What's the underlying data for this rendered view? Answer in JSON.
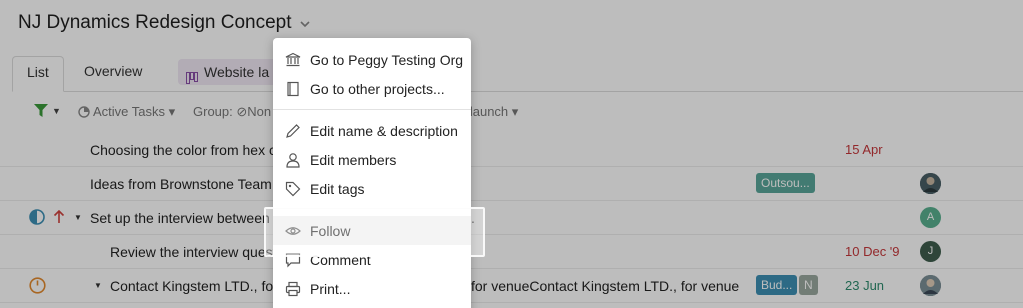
{
  "header": {
    "title": "NJ Dynamics Redesign Concept"
  },
  "tabs": [
    {
      "label": "List"
    },
    {
      "label": "Overview"
    },
    {
      "label": "Website la"
    }
  ],
  "filterbar": {
    "active_tasks": "Active Tasks",
    "group_prefix": "Group:",
    "group_value": "Non",
    "launch": "e launch"
  },
  "tasks": [
    {
      "name": "Choosing the color from hex c",
      "date": "15 Apr"
    },
    {
      "name": "Ideas from Brownstone Team",
      "tag": "Outsou..."
    },
    {
      "name": "Set up the interview between",
      "trailing": ".",
      "avatar": "A"
    },
    {
      "name": "Review the interview quest",
      "date": "10 Dec '9",
      "avatar": "J"
    },
    {
      "name": "Contact Kingstem LTD., for",
      "name_tail": "for venueContact Kingstem LTD., for venue",
      "tag": "Bud...",
      "tag2": "N",
      "date": "23 Jun"
    }
  ],
  "menu": {
    "items": [
      {
        "label": "Go to Peggy Testing Org",
        "icon": "bank-icon"
      },
      {
        "label": "Go to other projects...",
        "icon": "book-icon"
      },
      {
        "label": "Edit name & description",
        "icon": "pencil-icon"
      },
      {
        "label": "Edit members",
        "icon": "person-icon"
      },
      {
        "label": "Edit tags",
        "icon": "tag-icon"
      },
      {
        "label": "Follow",
        "icon": "eye-icon"
      },
      {
        "label": "Comment",
        "icon": "comment-icon"
      },
      {
        "label": "Print...",
        "icon": "printer-icon"
      }
    ]
  },
  "colors": {
    "tag_teal": "#5aa79a",
    "tag_blue": "#3d8fb4",
    "tag_grey": "#9aa9a0",
    "avatar_green": "#59b08f",
    "avatar_dark": "#3f5e4e",
    "date_red": "#c6373a",
    "date_green": "#2e8b6e"
  }
}
